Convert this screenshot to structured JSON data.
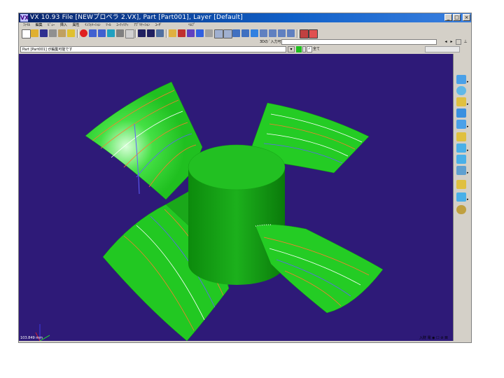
{
  "window": {
    "title": "VX 10.93     File [NEWプロペラ 2.VX], Part [Part001], Layer [Default]",
    "logo": "VX",
    "controls": [
      "_",
      "□",
      "×"
    ]
  },
  "menu": [
    "ﾌｧｲﾙ",
    "編集",
    "ﾋﾞｭｰ",
    "挿入",
    "属性",
    "ｲﾝﾌｫﾒｰｼｮﾝ",
    "ﾂｰﾙ",
    "ﾕｰﾃｨﾘﾃｨ",
    "ｱﾌﾟﾘｹｰｼｮﾝ",
    "ﾕｰｻﾞ",
    "ﾍﾙﾌﾟ"
  ],
  "input_row": {
    "label": "3Dの ﾞ入力可能"
  },
  "status": {
    "message": "Part [Part001] が編集可能です",
    "all_label": "全て"
  },
  "viewport": {
    "coord_readout": "103.849 mm",
    "background": "#2e1a78",
    "model_color": "#22cc22"
  },
  "bottom_tools": "入財 電 ◉ ☐ ⊘ 目",
  "right_toolbar_icons": [
    "box-icon",
    "sphere-grid-icon",
    "shape-icon",
    "cylinder-icon",
    "box-icon",
    "paint-icon",
    "rotate-icon",
    "face-icon",
    "plane-icon",
    "layer-icon",
    "shade-icon",
    "light-icon"
  ]
}
